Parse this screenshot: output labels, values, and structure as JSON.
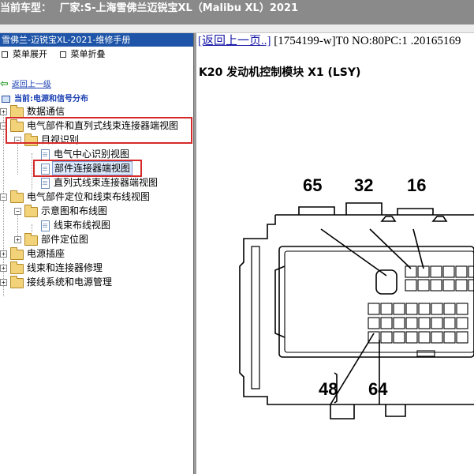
{
  "title_bar": {
    "label": "当前车型：",
    "maker": "厂家:S-上海雪佛兰迈锐宝XL（Malibu XL）2021"
  },
  "left_panel": {
    "header": "雪佛兰-迈锐宝XL-2021-维修手册",
    "menu": {
      "expand": "菜单展开",
      "collapse": "菜单折叠"
    },
    "back_label": "返回上一级",
    "current_label": "当前:电源和信号分布",
    "tree": [
      {
        "label": "数据通信"
      },
      {
        "label": "电气部件和直列式线束连接器端视图"
      },
      {
        "label": "目视识别"
      },
      {
        "label": "电气中心识别视图"
      },
      {
        "label": "部件连接器端视图"
      },
      {
        "label": "直列式线束连接器端视图"
      },
      {
        "label": "电气部件定位和线束布线视图"
      },
      {
        "label": "示意图和布线图"
      },
      {
        "label": "线束布线视图"
      },
      {
        "label": "部件定位图"
      },
      {
        "label": "电源插座"
      },
      {
        "label": "线束和连接器修理"
      },
      {
        "label": "接线系统和电源管理"
      }
    ]
  },
  "content": {
    "prev_link": "[返回上一页..]",
    "doc_info": "[1754199-w]T0 NO:80PC:1 .20165169",
    "module_title": "K20 发动机控制模块 X1 (LSY)",
    "pins": {
      "p65": "65",
      "p32": "32",
      "p16": "16",
      "p48": "48",
      "p64": "64"
    }
  },
  "colors": {
    "tree_header": "#1f55a8",
    "highlight_box": "#d62a2a",
    "title_bar": "#8a8a8a"
  }
}
